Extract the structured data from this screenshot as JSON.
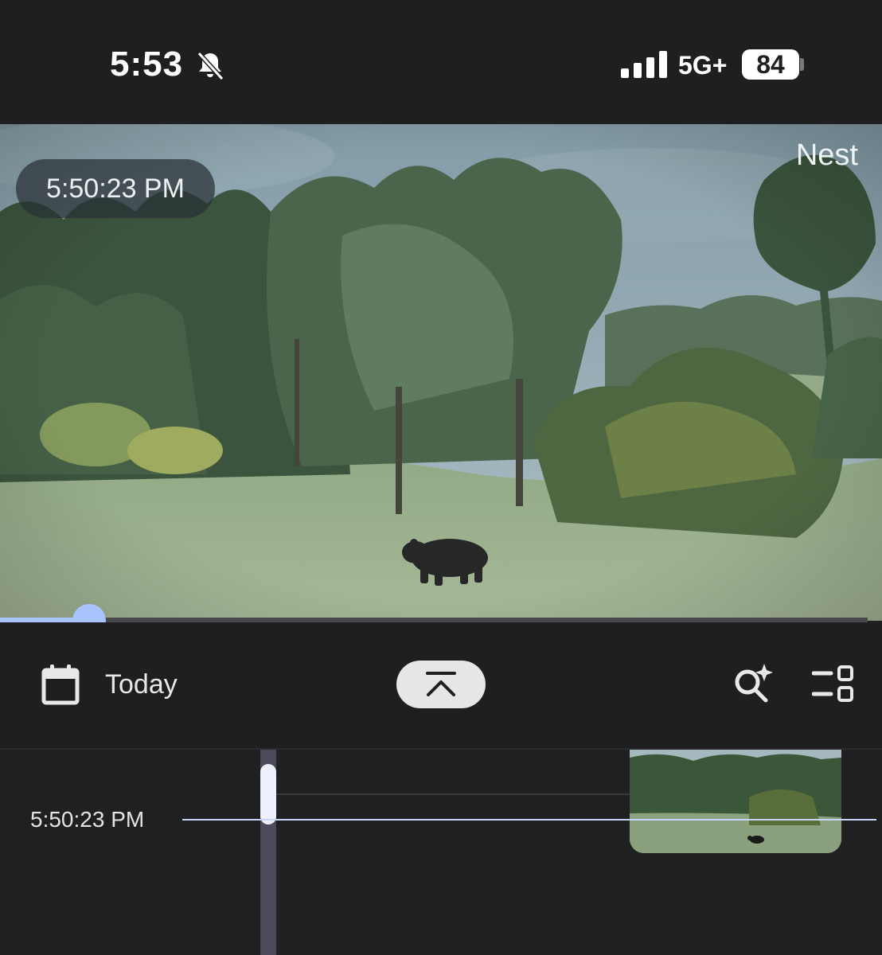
{
  "status_bar": {
    "time": "5:53",
    "network": "5G+",
    "battery": "84"
  },
  "video": {
    "timestamp": "5:50:23 PM",
    "brand": "Nest",
    "progress": 0.103
  },
  "toolbar": {
    "date_label": "Today"
  },
  "timeline": {
    "cursor_time": "5:50:23 PM"
  },
  "colors": {
    "accent": "#a8c4ff",
    "background": "#1f1f21"
  },
  "icons": [
    "bell-off-icon",
    "signal-icon",
    "calendar-icon",
    "chevron-up-bar-icon",
    "search-spark-icon",
    "filter-icon"
  ]
}
